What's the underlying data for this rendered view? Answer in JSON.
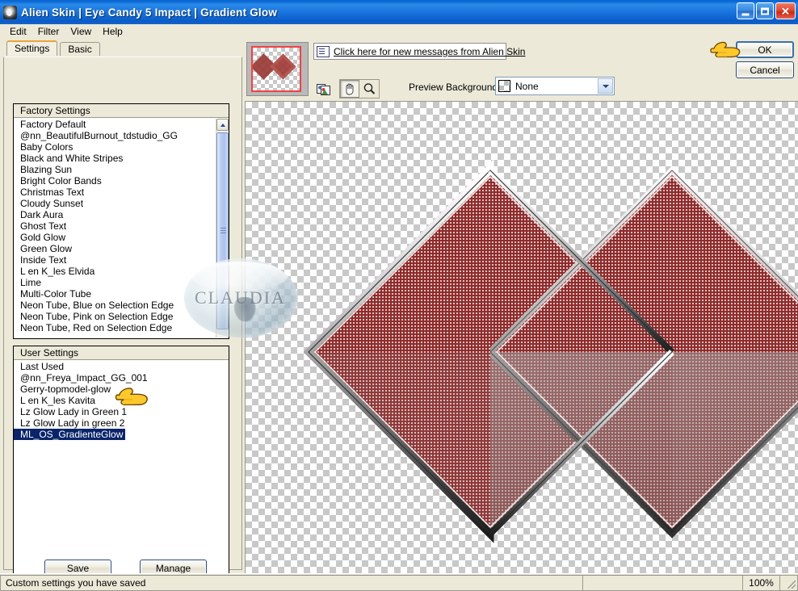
{
  "window": {
    "title": "Alien Skin  |  Eye Candy 5 Impact  |  Gradient Glow",
    "icon": "alien-head-icon",
    "minimize_label": "",
    "maximize_label": "",
    "close_label": "✕"
  },
  "menubar": {
    "items": [
      {
        "label": "Edit"
      },
      {
        "label": "Filter"
      },
      {
        "label": "View"
      },
      {
        "label": "Help"
      }
    ]
  },
  "tabs": [
    {
      "label": "Settings",
      "active": true
    },
    {
      "label": "Basic",
      "active": false
    }
  ],
  "factory_settings": {
    "header": "Factory Settings",
    "items": [
      "Factory Default",
      "@nn_BeautifulBurnout_tdstudio_GG",
      "Baby Colors",
      "Black and White Stripes",
      "Blazing Sun",
      "Bright Color Bands",
      "Christmas Text",
      "Cloudy Sunset",
      "Dark Aura",
      "Ghost Text",
      "Gold Glow",
      "Green Glow",
      "Inside Text",
      "L en K_les Elvida",
      "Lime",
      "Multi-Color Tube",
      "Neon Tube, Blue on Selection Edge",
      "Neon Tube, Pink on Selection Edge",
      "Neon Tube, Red on Selection Edge"
    ]
  },
  "user_settings": {
    "header": "User Settings",
    "items": [
      "Last Used",
      "@nn_Freya_Impact_GG_001",
      "Gerry-topmodel-glow",
      "L en K_les Kavita",
      "Lz Glow Lady in Green 1",
      "Lz Glow Lady in green 2",
      "ML_OS_GradienteGlow"
    ],
    "selected": "ML_OS_GradienteGlow"
  },
  "panel_buttons": {
    "save": "Save",
    "manage": "Manage"
  },
  "message_bar": {
    "icon": "message-envelope-icon",
    "link_text": "Click here for new messages from Alien Skin"
  },
  "toolbar": {
    "preview_tool_icon": "image-compare-icon",
    "pan_tool_icon": "hand-icon",
    "zoom_tool_icon": "magnifier-icon"
  },
  "preview_background": {
    "label": "Preview Background:",
    "value": "None",
    "swatch": "checkerboard-swatch"
  },
  "dialog_buttons": {
    "ok": "OK",
    "cancel": "Cancel"
  },
  "statusbar": {
    "message": "Custom settings you have saved",
    "middle": "",
    "zoom": "100%"
  },
  "watermark": {
    "text": "CLAUDIA"
  },
  "colors": {
    "titlebar_blue": "#1a74dd",
    "selection_blue": "#0a246a",
    "panel_bg": "#ece9d8",
    "shape_red": "#8f2b2b",
    "accent_orange": "#e8a33d",
    "hand_yellow": "#ffcc33"
  },
  "preview": {
    "shape": "two-overlapping-diamonds",
    "fill_color": "#8f2b2b",
    "glow_color": "#9a9a9a",
    "background": "transparent-checkerboard"
  }
}
